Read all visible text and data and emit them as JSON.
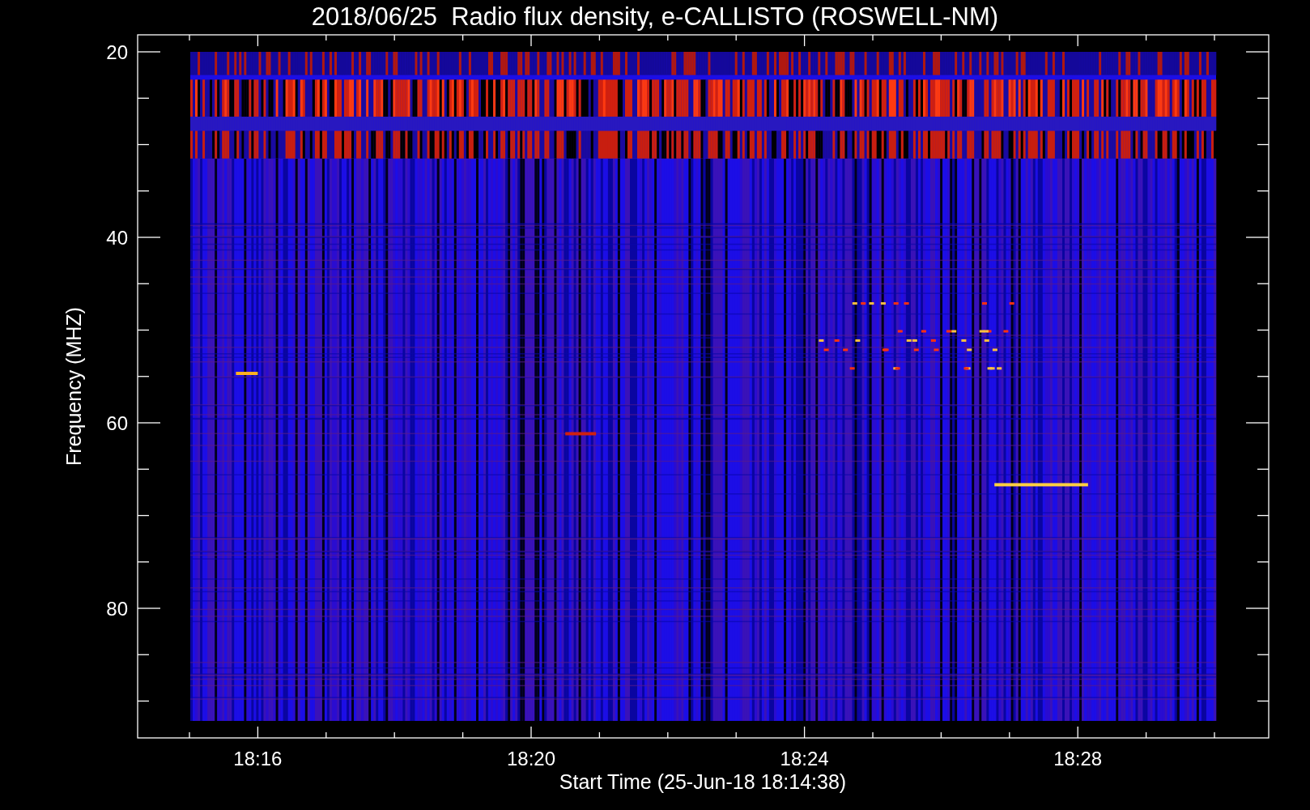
{
  "title": "2018/06/25  Radio flux density, e-CALLISTO (ROSWELL-NM)",
  "plot": {
    "xlabel": "Start Time (25-Jun-18 18:14:38)",
    "ylabel": "Frequency (MHZ)",
    "xticks": [
      "18:16",
      "18:20",
      "18:24",
      "18:28"
    ],
    "yticks": [
      "20",
      "40",
      "60",
      "80"
    ]
  }
}
